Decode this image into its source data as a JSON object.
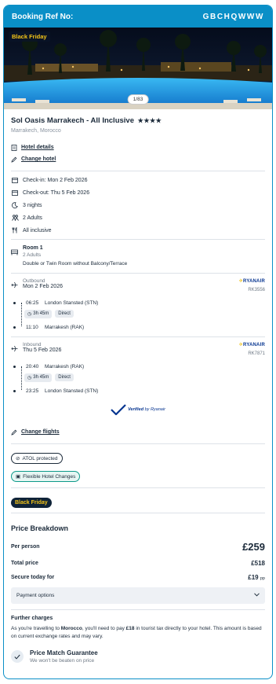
{
  "header": {
    "label": "Booking Ref No:",
    "ref": "GBCHQWWW"
  },
  "hero": {
    "badge": "Black Friday",
    "counter": "1/83"
  },
  "hotel": {
    "name": "Sol Oasis Marrakech - All Inclusive",
    "stars": "★★★★",
    "location": "Marrakech, Morocco",
    "details_link": "Hotel details",
    "change_link": "Change hotel"
  },
  "stay": {
    "checkin": "Check-in: Mon 2 Feb 2026",
    "checkout": "Check-out: Thu 5 Feb 2026",
    "nights": "3 nights",
    "guests": "2 Adults",
    "board": "All inclusive"
  },
  "room": {
    "title": "Room 1",
    "guests": "2 Adults",
    "description": "Double or Twin Room without Balcony/Terrace"
  },
  "flights": {
    "outbound": {
      "label": "Outbound",
      "date": "Mon 2 Feb 2026",
      "airline": "RYANAIR",
      "code": "RK3556",
      "dep_time": "06:25",
      "dep_airport": "London Stansted (STN)",
      "duration": "3h 45m",
      "type": "Direct",
      "arr_time": "11:10",
      "arr_airport": "Marrakesh (RAK)"
    },
    "inbound": {
      "label": "Inbound",
      "date": "Thu 5 Feb 2026",
      "airline": "RYANAIR",
      "code": "RK7871",
      "dep_time": "20:40",
      "dep_airport": "Marrakesh (RAK)",
      "duration": "3h 45m",
      "type": "Direct",
      "arr_time": "23:25",
      "arr_airport": "London Stansted (STN)"
    },
    "verified_prefix": "Verified",
    "verified_suffix": "by Ryanair",
    "change_link": "Change flights"
  },
  "tags": {
    "atol": "ATOL protected",
    "flexible": "Flexible Hotel Changes",
    "black_friday": "Black Friday"
  },
  "price": {
    "title": "Price Breakdown",
    "per_person_label": "Per person",
    "per_person": "£259",
    "total_label": "Total price",
    "total": "£518",
    "today_label": "Secure today for",
    "today": "£19",
    "today_unit": "pp",
    "payment_options": "Payment options"
  },
  "further": {
    "title": "Further charges",
    "text_1": "As you're travelling to ",
    "country": "Morocco",
    "text_2": ", you'll need to pay ",
    "amount": "£18",
    "text_3": " in tourist tax directly to your hotel. This amount is based on current exchange rates and may vary."
  },
  "guarantee": {
    "title": "Price Match Guarantee",
    "subtitle": "We won't be beaten on price"
  },
  "colors": {
    "accent": "#0a8fc7",
    "ryanair_blue": "#073590",
    "ryanair_yellow": "#f1c933",
    "black_friday": "#f5c518"
  }
}
